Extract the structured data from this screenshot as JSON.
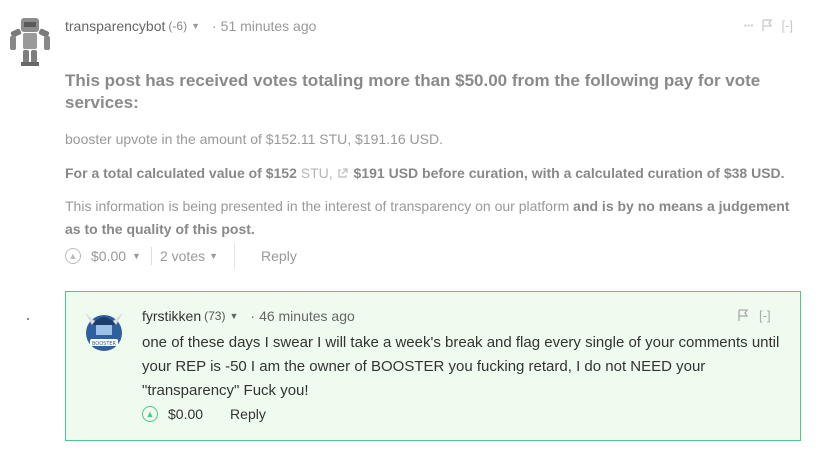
{
  "comment1": {
    "author": "transparencybot",
    "reputation": "(-6)",
    "time": "51 minutes ago",
    "heading": "This post has received votes totaling more than $50.00 from the following pay for vote services:",
    "line1": "booster upvote in the amount of $152.11 STU, $191.16 USD.",
    "line2_a": "For a total calculated value of $152 ",
    "line2_link": "STU,",
    "line2_b": " $191 USD before curation, with a calculated curation of $38 USD.",
    "line3_a": "This information is being presented in the interest of transparency on our platform ",
    "line3_b": "and is by no means a judgement as to the quality of this post.",
    "payout": "$0.00",
    "votes": "2 votes",
    "reply_label": "Reply",
    "menu_icon": "ellipsis-icon",
    "flag_icon": "flag-icon",
    "collapse_label": "[-]"
  },
  "comment2": {
    "author": "fyrstikken",
    "reputation": "(73)",
    "time": "46 minutes ago",
    "body": "one of these days I swear I will take a week's break and flag every single of your comments until your REP is -50 I am the owner of BOOSTER you fucking retard, I do not NEED your \"transparency\" Fuck you!",
    "payout": "$0.00",
    "reply_label": "Reply",
    "flag_icon": "flag-icon",
    "collapse_label": "[-]",
    "border_color": "#4cc98a",
    "background": "#effbee"
  }
}
